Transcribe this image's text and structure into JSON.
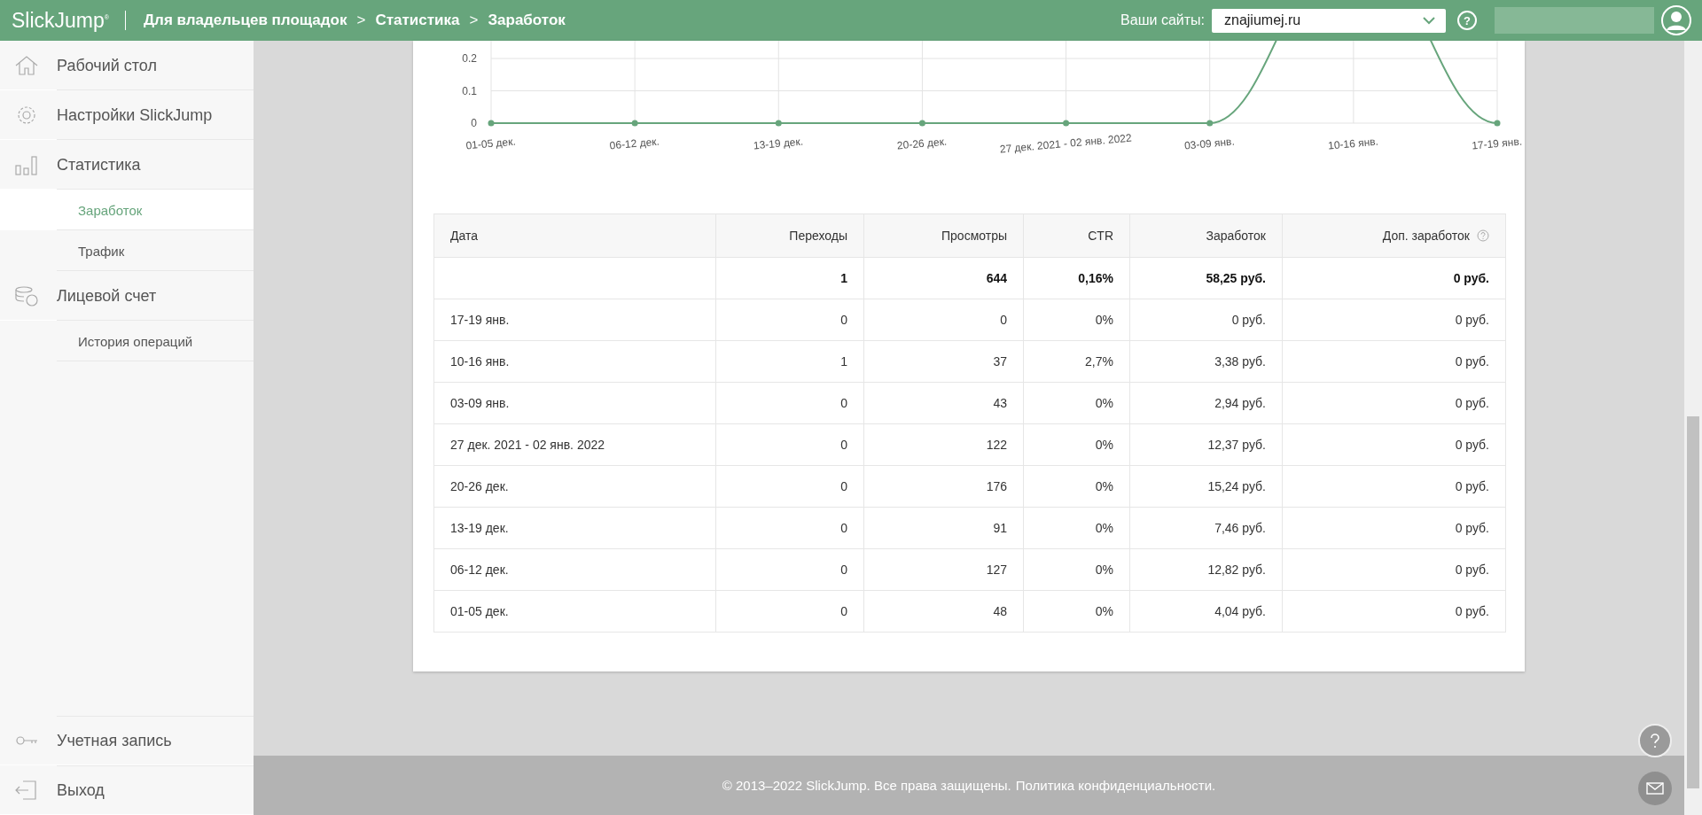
{
  "header": {
    "logo": "SlickJump",
    "logo_mark": "®",
    "breadcrumbs": [
      "Для владельцев площадок",
      "Статистика",
      "Заработок"
    ],
    "breadcrumb_separator": ">",
    "sites_label": "Ваши сайты:",
    "site_select": {
      "value": "znajiumej.ru"
    },
    "help": "?"
  },
  "sidebar": {
    "items": [
      {
        "label": "Рабочий стол",
        "selected": false
      },
      {
        "label": "Настройки SlickJump",
        "selected": false
      },
      {
        "label": "Статистика",
        "selected": false,
        "children": [
          {
            "label": "Заработок",
            "selected": true
          },
          {
            "label": "Трафик",
            "selected": false
          }
        ]
      },
      {
        "label": "Лицевой счет",
        "selected": false,
        "children": [
          {
            "label": "История операций",
            "selected": false
          }
        ]
      }
    ],
    "bottom_items": [
      {
        "label": "Учетная запись"
      },
      {
        "label": "Выход"
      }
    ]
  },
  "chart_data": {
    "type": "line",
    "categories": [
      "01-05 дек.",
      "06-12 дек.",
      "13-19 дек.",
      "20-26 дек.",
      "27 дек. 2021 - 02 янв. 2022",
      "03-09 янв.",
      "10-16 янв.",
      "17-19 янв."
    ],
    "yticks": [
      0,
      0.1,
      0.2
    ],
    "ylim": [
      0,
      0.255
    ],
    "grid": true,
    "series": [
      {
        "color": "#67a57c",
        "marker": "circle",
        "values": [
          0,
          0,
          0,
          0,
          0,
          0,
          null,
          0
        ]
      }
    ]
  },
  "table": {
    "columns": [
      "Дата",
      "Переходы",
      "Просмотры",
      "CTR",
      "Заработок",
      "Доп. заработок"
    ],
    "rows": [
      {
        "kind": "total",
        "cells": [
          "",
          "1",
          "644",
          "0,16%",
          "58,25 руб.",
          "0 руб."
        ]
      },
      {
        "kind": "data",
        "cells": [
          "17-19 янв.",
          "0",
          "0",
          "0%",
          "0 руб.",
          "0 руб."
        ]
      },
      {
        "kind": "data",
        "cells": [
          "10-16 янв.",
          "1",
          "37",
          "2,7%",
          "3,38 руб.",
          "0 руб."
        ]
      },
      {
        "kind": "data",
        "cells": [
          "03-09 янв.",
          "0",
          "43",
          "0%",
          "2,94 руб.",
          "0 руб."
        ]
      },
      {
        "kind": "data",
        "cells": [
          "27 дек. 2021 - 02 янв. 2022",
          "0",
          "122",
          "0%",
          "12,37 руб.",
          "0 руб."
        ]
      },
      {
        "kind": "data",
        "cells": [
          "20-26 дек.",
          "0",
          "176",
          "0%",
          "15,24 руб.",
          "0 руб."
        ]
      },
      {
        "kind": "data",
        "cells": [
          "13-19 дек.",
          "0",
          "91",
          "0%",
          "7,46 руб.",
          "0 руб."
        ]
      },
      {
        "kind": "data",
        "cells": [
          "06-12 дек.",
          "0",
          "127",
          "0%",
          "12,82 руб.",
          "0 руб."
        ]
      },
      {
        "kind": "data",
        "cells": [
          "01-05 дек.",
          "0",
          "48",
          "0%",
          "4,04 руб.",
          "0 руб."
        ]
      }
    ]
  },
  "footer": {
    "text": "© 2013–2022 SlickJump. Все права защищены.",
    "link": "Политика конфиденциальности."
  }
}
